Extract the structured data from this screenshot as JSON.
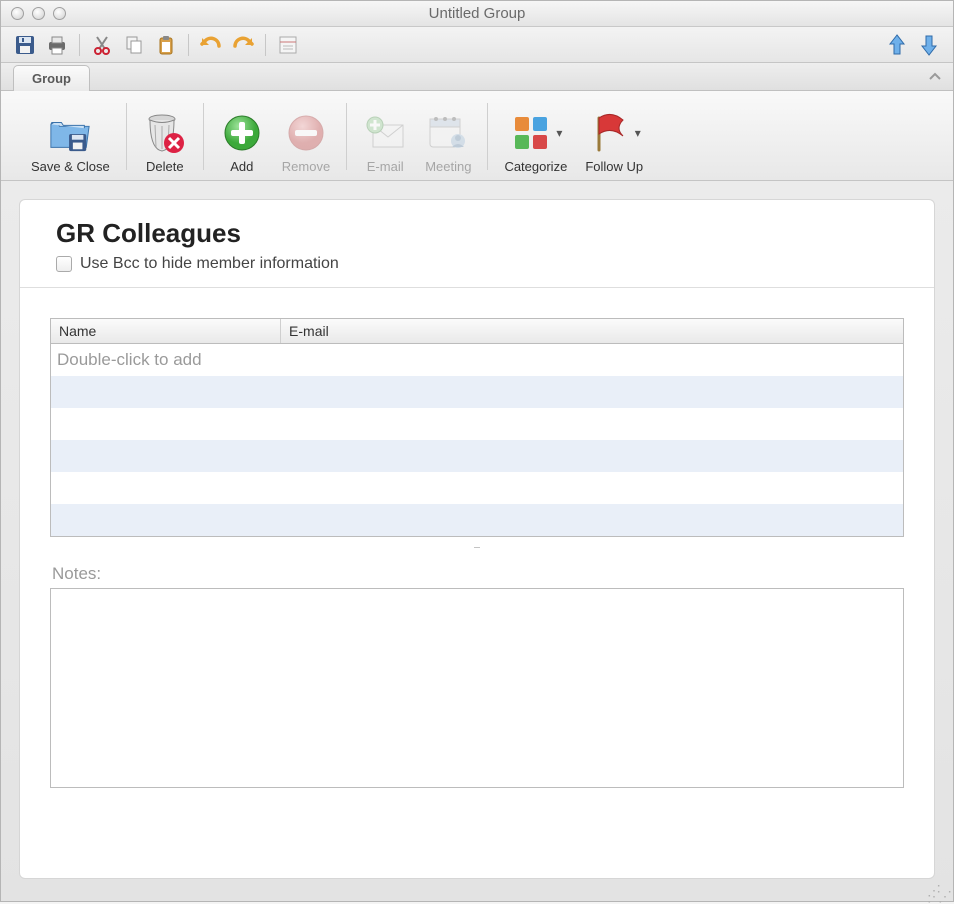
{
  "window": {
    "title": "Untitled Group"
  },
  "tab": {
    "label": "Group"
  },
  "ribbon": {
    "save_close": "Save & Close",
    "delete": "Delete",
    "add": "Add",
    "remove": "Remove",
    "email": "E-mail",
    "meeting": "Meeting",
    "categorize": "Categorize",
    "follow_up": "Follow Up"
  },
  "group": {
    "name": "GR Colleagues",
    "bcc_label": "Use Bcc to hide member information",
    "bcc_checked": false,
    "table": {
      "headers": {
        "name": "Name",
        "email": "E-mail"
      },
      "placeholder": "Double-click to add",
      "rows": []
    },
    "notes_label": "Notes:",
    "notes": ""
  }
}
